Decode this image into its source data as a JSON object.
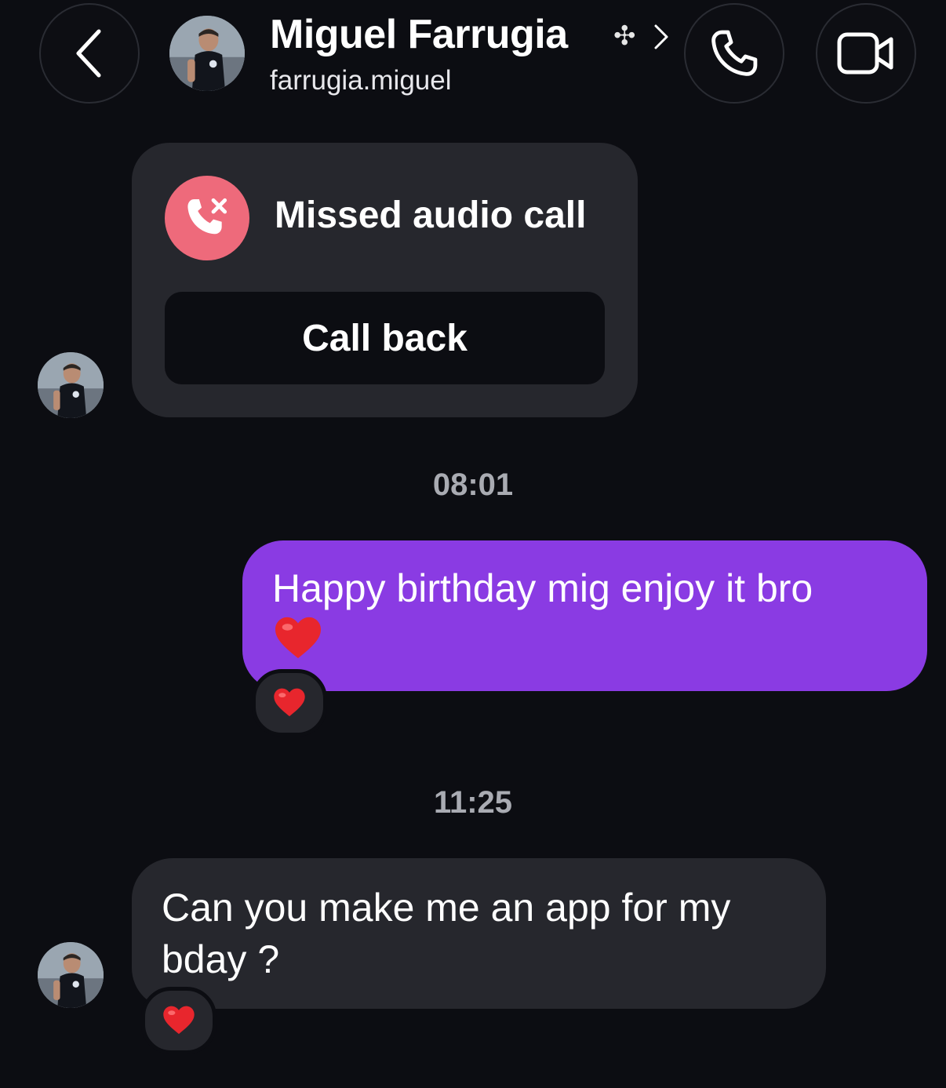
{
  "header": {
    "back_icon": "chevron-left-icon",
    "contact_name": "Miguel Farrugia",
    "name_symbol": "✣",
    "chevron_icon": "chevron-right-icon",
    "username": "farrugia.miguel",
    "audio_call_icon": "phone-icon",
    "video_call_icon": "video-camera-icon"
  },
  "messages": {
    "missed_call": {
      "icon": "missed-call-icon",
      "label": "Missed audio call",
      "button_label": "Call back"
    },
    "timestamp_1": "08:01",
    "sent": {
      "text": "Happy birthday mig enjoy it bro",
      "emoji": "❤️",
      "reaction": "❤️"
    },
    "timestamp_2": "11:25",
    "received": {
      "line1": "Can you make me an app for my",
      "line2": "bday ?",
      "reaction": "❤️"
    }
  },
  "colors": {
    "background": "#0c0d12",
    "bubble_sent": "#8a3be3",
    "bubble_received": "#26272d",
    "missed_call_red": "#ee6a7b",
    "timestamp": "#a9abb2"
  }
}
